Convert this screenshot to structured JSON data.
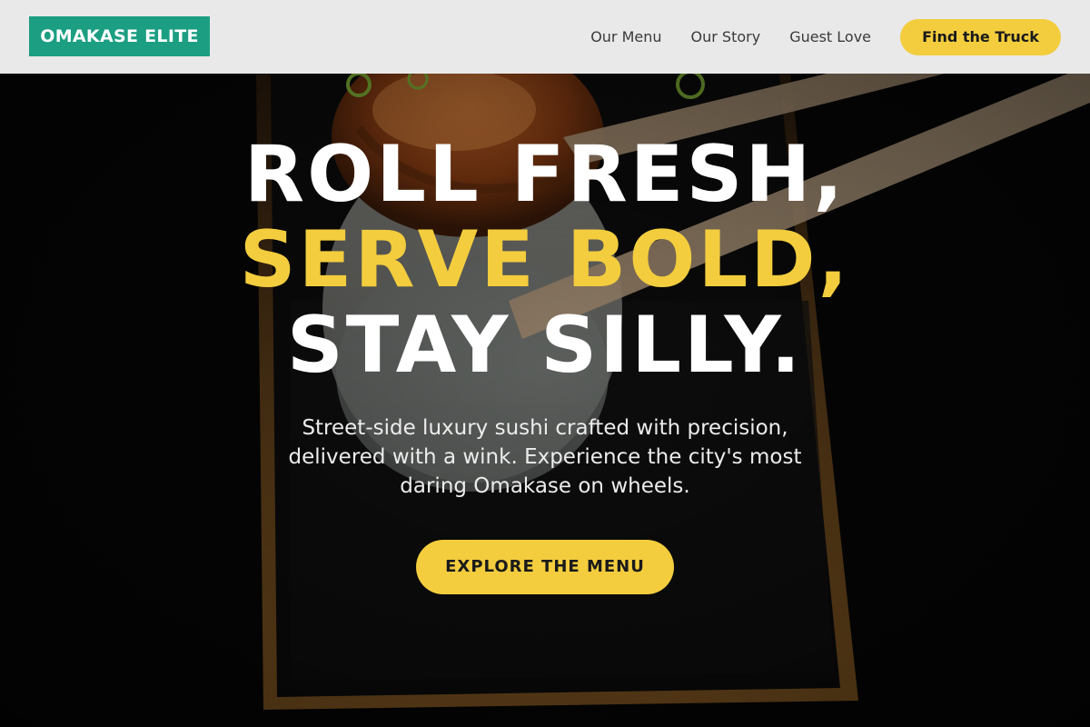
{
  "header": {
    "logo_text": "OMAKASE ELITE",
    "nav": [
      "Our Menu",
      "Our Story",
      "Guest Love"
    ],
    "cta_label": "Find the Truck"
  },
  "hero": {
    "headline": [
      "ROLL FRESH,",
      "SERVE BOLD,",
      "STAY SILLY."
    ],
    "subtext": "Street-side luxury sushi crafted with precision, delivered with a wink. Experience the city's most daring Omakase on wheels.",
    "cta_label": "EXPLORE THE MENU",
    "background_image": "sushi-roll-held-with-chopsticks"
  },
  "colors": {
    "accent_yellow": "#f3cd3e",
    "logo_green": "#1b9e82",
    "header_bg": "#e9e9e9",
    "hero_bg": "#060606"
  }
}
